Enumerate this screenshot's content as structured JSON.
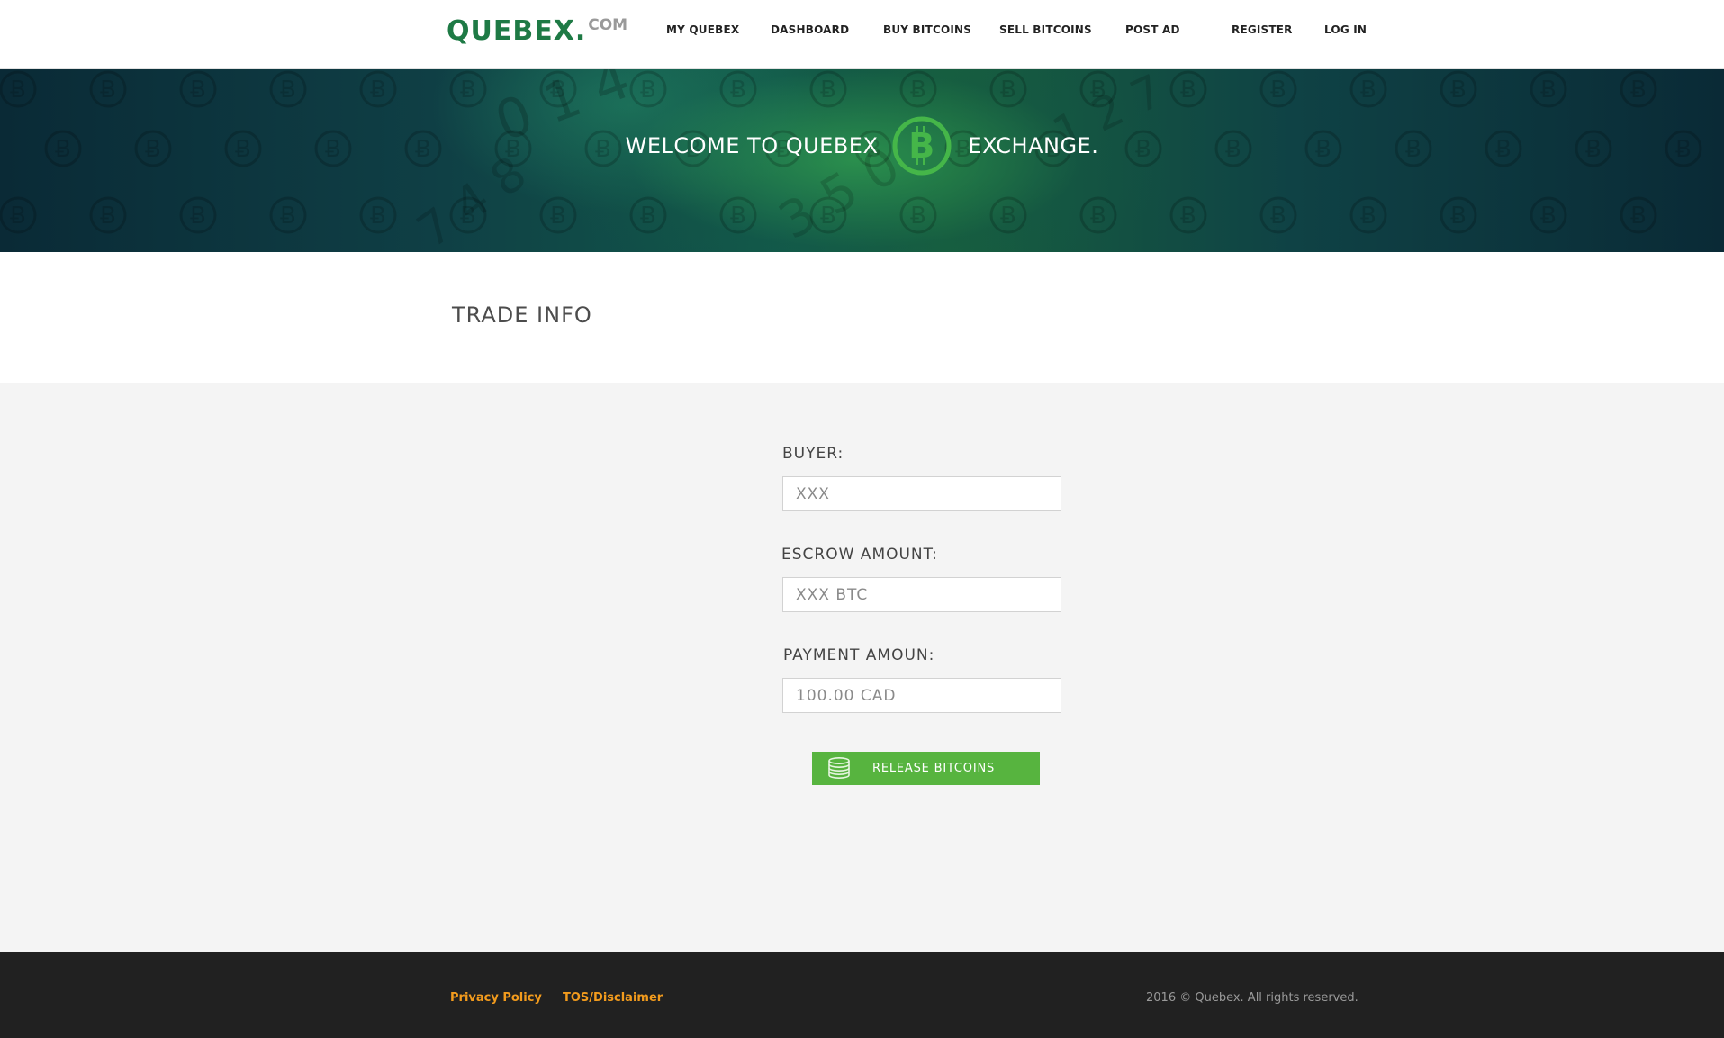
{
  "header": {
    "logo_main": "QUEBEX.",
    "logo_tld": "COM",
    "nav": {
      "my_quebex": "MY QUEBEX",
      "dashboard": "DASHBOARD",
      "buy_bitcoins": "BUY BITCOINS",
      "sell_bitcoins": "SELL BITCOINS",
      "post_ad": "POST AD",
      "register": "REGISTER",
      "log_in": "LOG IN"
    }
  },
  "hero": {
    "title_part1": "WELCOME TO QUEBEX",
    "title_part2": "EXCHANGE.",
    "icon": "bitcoin-logo-icon",
    "accent_color": "#45b649"
  },
  "trade_info": {
    "title": "TRADE INFO"
  },
  "form": {
    "buyer": {
      "label": "BUYER:",
      "placeholder": "XXX"
    },
    "escrow_amount": {
      "label": "ESCROW AMOUNT:",
      "placeholder": "XXX BTC"
    },
    "payment_amount": {
      "label": "PAYMENT AMOUN:",
      "placeholder": "100.00 CAD"
    },
    "release_button": {
      "label": "RELEASE BITCOINS",
      "icon": "coin-stack-icon",
      "color": "#57b43f"
    }
  },
  "footer": {
    "privacy_policy": "Privacy Policy",
    "tos": "TOS/Disclaimer",
    "copyright": "2016 © Quebex. All rights reserved.",
    "link_color": "#f29b1d"
  }
}
